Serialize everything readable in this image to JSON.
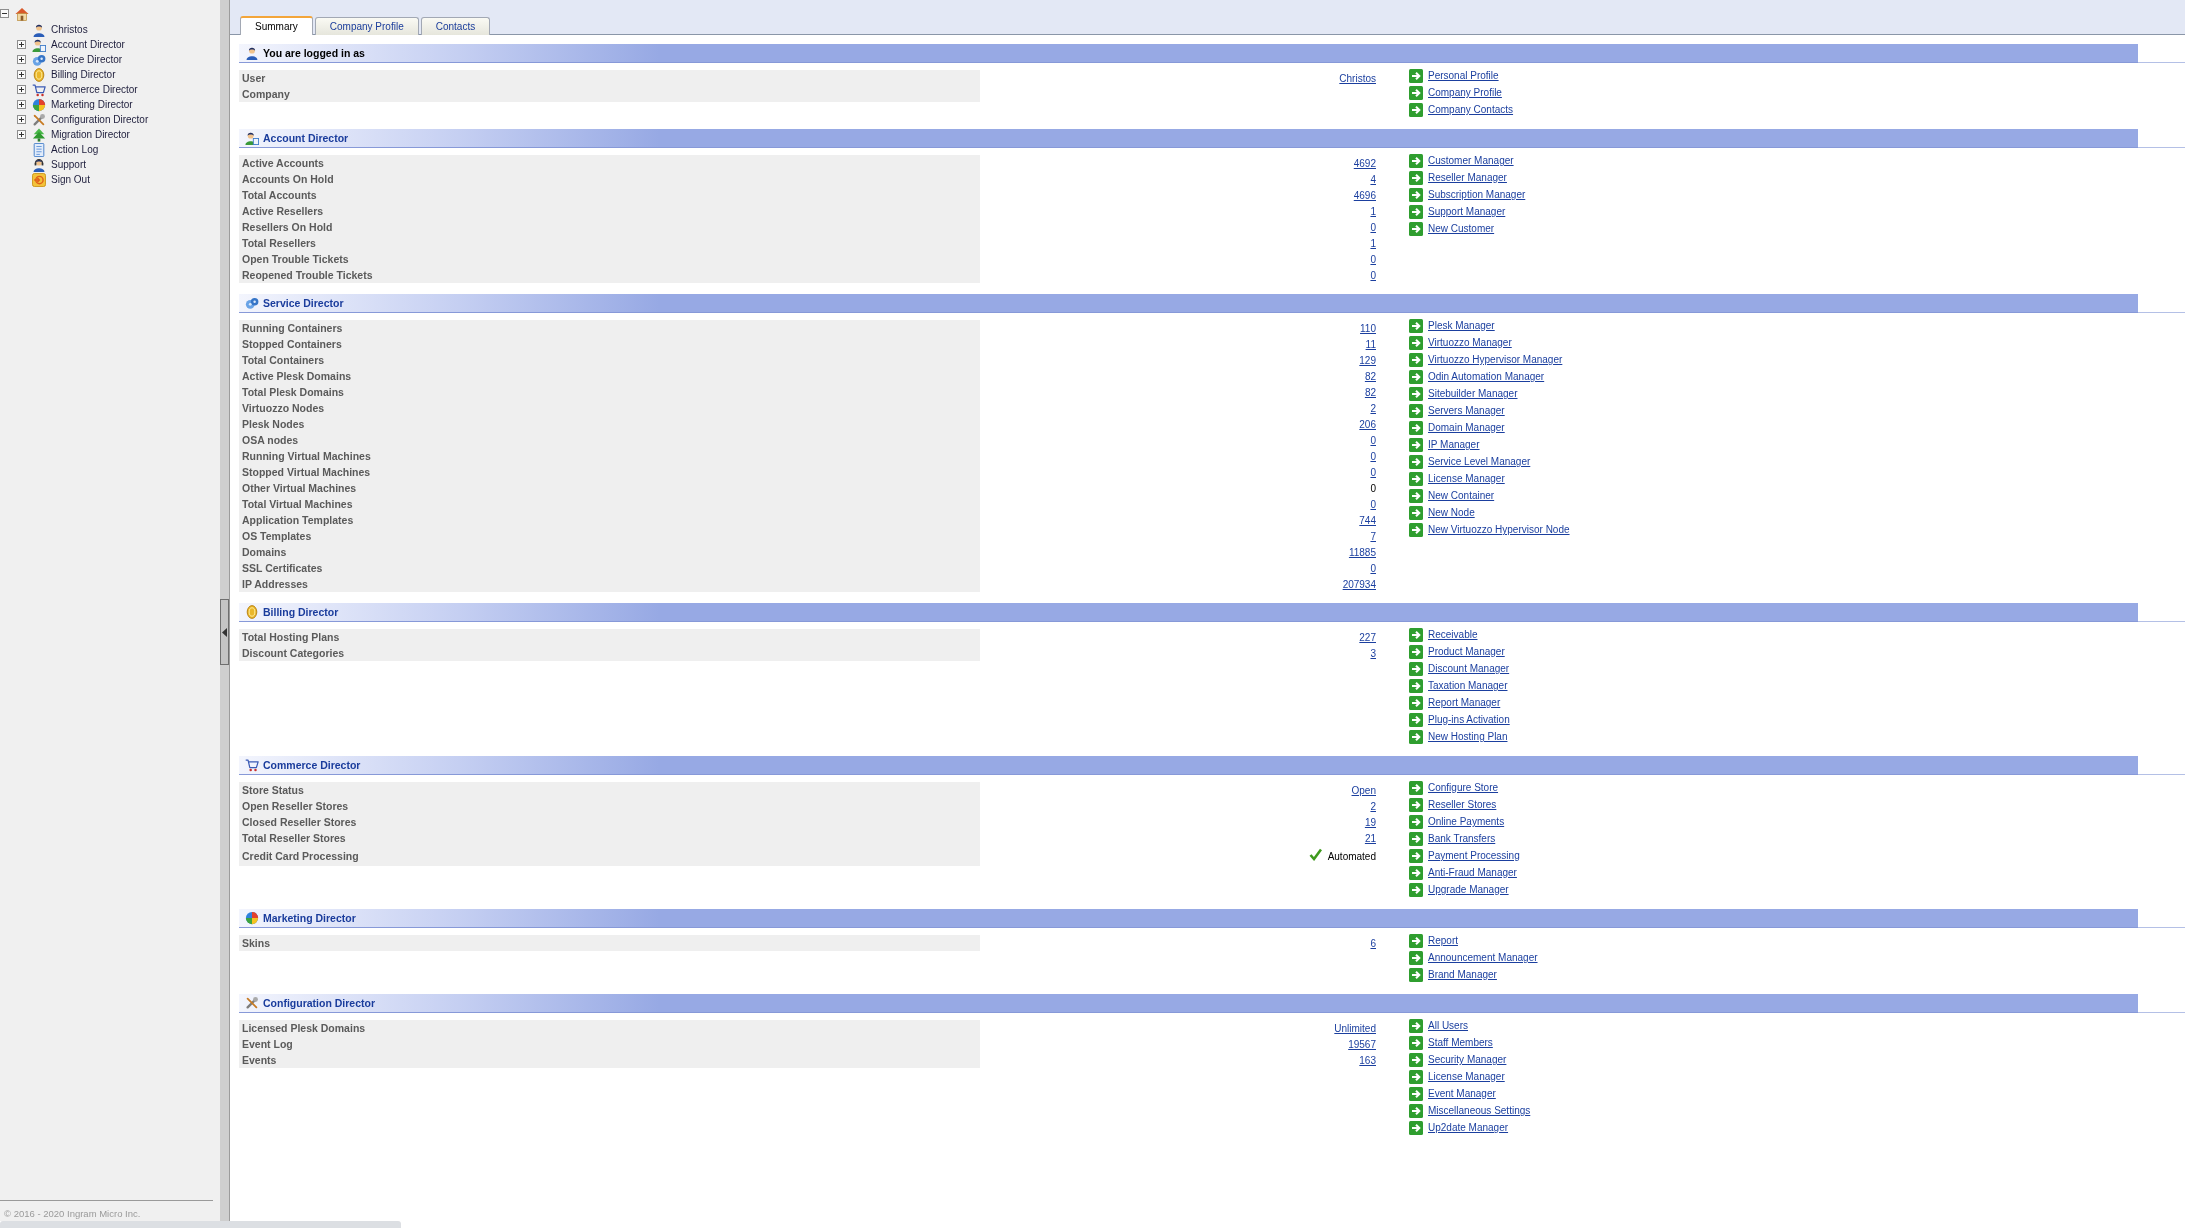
{
  "sidebar": {
    "tree": {
      "expanded": true,
      "children": [
        {
          "label": "Christos",
          "kind": "leaf"
        },
        {
          "label": "Account Director",
          "kind": "group",
          "expanded": false
        },
        {
          "label": "Service Director",
          "kind": "group",
          "expanded": false
        },
        {
          "label": "Billing Director",
          "kind": "group",
          "expanded": false
        },
        {
          "label": "Commerce Director",
          "kind": "group",
          "expanded": false
        },
        {
          "label": "Marketing Director",
          "kind": "group",
          "expanded": false
        },
        {
          "label": "Configuration Director",
          "kind": "group",
          "expanded": false
        },
        {
          "label": "Migration Director",
          "kind": "group",
          "expanded": false
        },
        {
          "label": "Action Log",
          "kind": "leaf"
        },
        {
          "label": "Support",
          "kind": "leaf"
        },
        {
          "label": "Sign Out",
          "kind": "leaf"
        }
      ]
    },
    "footer": "© 2016 - 2020 Ingram Micro Inc."
  },
  "tabs": [
    {
      "label": "Summary",
      "selected": true
    },
    {
      "label": "Company Profile",
      "selected": false
    },
    {
      "label": "Contacts",
      "selected": false
    }
  ],
  "sections": [
    {
      "title": "You are logged in as",
      "kind": "plain",
      "rows": [
        {
          "label": "User",
          "value": "Christos",
          "kind": "link"
        },
        {
          "label": "Company"
        }
      ],
      "links": [
        "Personal Profile",
        "Company Profile",
        "Company Contacts"
      ]
    },
    {
      "title": "Account Director",
      "kind": "link",
      "rows": [
        {
          "label": "Active Accounts",
          "value": "4692",
          "kind": "link"
        },
        {
          "label": "Accounts On Hold",
          "value": "4",
          "kind": "link"
        },
        {
          "label": "Total Accounts",
          "value": "4696",
          "kind": "link"
        },
        {
          "label": "Active Resellers",
          "value": "1",
          "kind": "link"
        },
        {
          "label": "Resellers On Hold",
          "value": "0",
          "kind": "link"
        },
        {
          "label": "Total Resellers",
          "value": "1",
          "kind": "link"
        },
        {
          "label": "Open Trouble Tickets",
          "value": "0",
          "kind": "link"
        },
        {
          "label": "Reopened Trouble Tickets",
          "value": "0",
          "kind": "link"
        }
      ],
      "links": [
        "Customer Manager",
        "Reseller Manager",
        "Subscription Manager",
        "Support Manager",
        "New Customer"
      ]
    },
    {
      "title": "Service Director",
      "kind": "link",
      "rows": [
        {
          "label": "Running Containers",
          "value": "110",
          "kind": "link"
        },
        {
          "label": "Stopped Containers",
          "value": "11",
          "kind": "link"
        },
        {
          "label": "Total Containers",
          "value": "129",
          "kind": "link"
        },
        {
          "label": "Active Plesk Domains",
          "value": "82",
          "kind": "link"
        },
        {
          "label": "Total Plesk Domains",
          "value": "82",
          "kind": "link"
        },
        {
          "label": "Virtuozzo Nodes",
          "value": "2",
          "kind": "link"
        },
        {
          "label": "Plesk Nodes",
          "value": "206",
          "kind": "link"
        },
        {
          "label": "OSA nodes",
          "value": "0",
          "kind": "link"
        },
        {
          "label": "Running Virtual Machines",
          "value": "0",
          "kind": "link"
        },
        {
          "label": "Stopped Virtual Machines",
          "value": "0",
          "kind": "link"
        },
        {
          "label": "Other Virtual Machines",
          "value": "0",
          "kind": "text"
        },
        {
          "label": "Total Virtual Machines",
          "value": "0",
          "kind": "link"
        },
        {
          "label": "Application Templates",
          "value": "744",
          "kind": "link"
        },
        {
          "label": "OS Templates",
          "value": "7",
          "kind": "link"
        },
        {
          "label": "Domains",
          "value": "11885",
          "kind": "link"
        },
        {
          "label": "SSL Certificates",
          "value": "0",
          "kind": "link"
        },
        {
          "label": "IP Addresses",
          "value": "207934",
          "kind": "link"
        }
      ],
      "links": [
        "Plesk Manager",
        "Virtuozzo Manager",
        "Virtuozzo Hypervisor Manager",
        "Odin Automation Manager",
        "Sitebuilder Manager",
        "Servers Manager",
        "Domain Manager",
        "IP Manager",
        "Service Level Manager",
        "License Manager",
        "New Container",
        "New Node",
        "New Virtuozzo Hypervisor Node"
      ]
    },
    {
      "title": "Billing Director",
      "kind": "link",
      "rows": [
        {
          "label": "Total Hosting Plans",
          "value": "227",
          "kind": "link"
        },
        {
          "label": "Discount Categories",
          "value": "3",
          "kind": "link"
        }
      ],
      "links": [
        "Receivable",
        "Product Manager",
        "Discount Manager",
        "Taxation Manager",
        "Report Manager",
        "Plug-ins Activation",
        "New Hosting Plan"
      ]
    },
    {
      "title": "Commerce Director",
      "kind": "link",
      "rows": [
        {
          "label": "Store Status",
          "value": "Open",
          "kind": "link"
        },
        {
          "label": "Open Reseller Stores",
          "value": "2",
          "kind": "link"
        },
        {
          "label": "Closed Reseller Stores",
          "value": "19",
          "kind": "link"
        },
        {
          "label": "Total Reseller Stores",
          "value": "21",
          "kind": "link"
        },
        {
          "label": "Credit Card Processing",
          "value": "Automated",
          "kind": "check"
        }
      ],
      "links": [
        "Configure Store",
        "Reseller Stores",
        "Online Payments",
        "Bank Transfers",
        "Payment Processing",
        "Anti-Fraud Manager",
        "Upgrade Manager"
      ]
    },
    {
      "title": "Marketing Director",
      "kind": "link",
      "rows": [
        {
          "label": "Skins",
          "value": "6",
          "kind": "link"
        }
      ],
      "links": [
        "Report",
        "Announcement Manager",
        "Brand Manager"
      ]
    },
    {
      "title": "Configuration Director",
      "kind": "link",
      "rows": [
        {
          "label": "Licensed Plesk Domains",
          "value": "Unlimited",
          "kind": "link"
        },
        {
          "label": "Event Log",
          "value": "19567",
          "kind": "link"
        },
        {
          "label": "Events",
          "value": "163",
          "kind": "link"
        }
      ],
      "links": [
        "All Users",
        "Staff Members",
        "Security Manager",
        "License Manager",
        "Event Manager",
        "Miscellaneous Settings",
        "Up2date Manager"
      ]
    }
  ]
}
